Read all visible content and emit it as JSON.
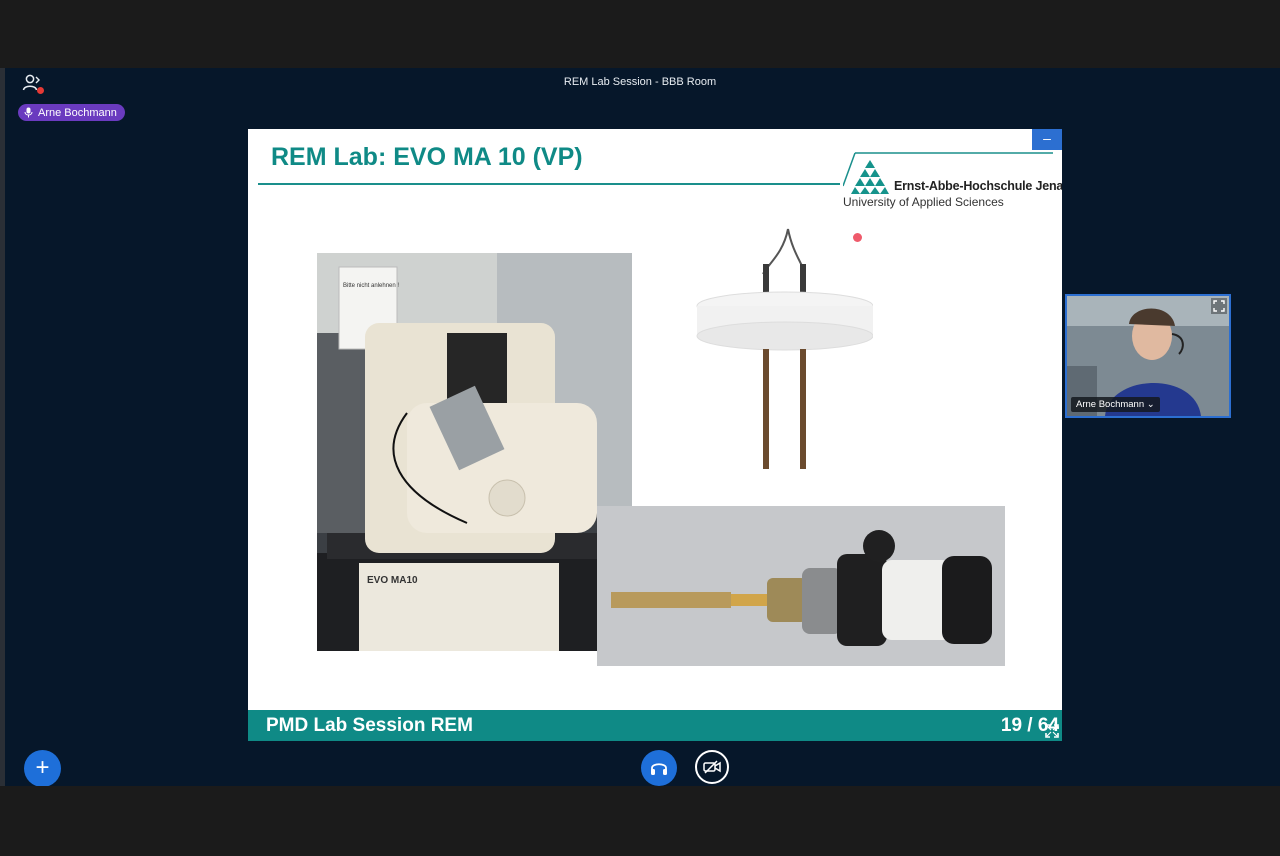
{
  "window": {
    "room_title": "REM Lab Session - BBB Room"
  },
  "presenter_badge": {
    "name": "Arne Bochmann",
    "icon": "mic-icon"
  },
  "slide": {
    "title": "REM Lab: EVO MA 10 (VP)",
    "logo_name": "Ernst-Abbe-Hochschule Jena",
    "logo_subtitle": "University of Applied Sciences",
    "microscope_caption": "EVO MA10",
    "sign_text": "Bitte nicht anlehnen !",
    "footer_left": "PMD Lab Session REM",
    "footer_right": "19 / 64"
  },
  "webcam": {
    "participant_name": "Arne Bochmann ⌄"
  },
  "controls": {
    "plus_label": "+",
    "minimize_label": "–"
  },
  "colors": {
    "app_background": "#06172a",
    "accent_blue": "#1e6fd9",
    "slide_teal": "#0f8a86",
    "talker_badge": "#6a3bbf"
  }
}
